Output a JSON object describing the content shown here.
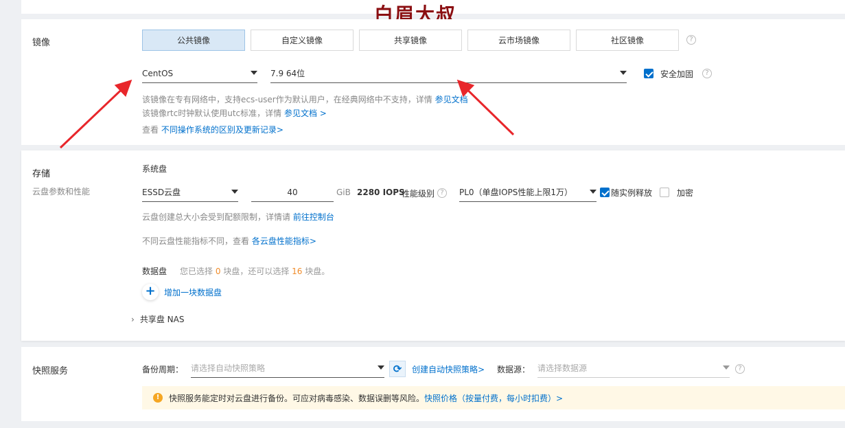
{
  "watermark": "白眉大叔",
  "image": {
    "section_label": "镜像",
    "tabs": [
      {
        "label": "公共镜像",
        "active": true
      },
      {
        "label": "自定义镜像",
        "active": false
      },
      {
        "label": "共享镜像",
        "active": false
      },
      {
        "label": "云市场镜像",
        "active": false
      },
      {
        "label": "社区镜像",
        "active": false
      }
    ],
    "os_value": "CentOS",
    "version_value": "7.9 64位",
    "security_label": "安全加固",
    "security_checked": true,
    "note1_prefix": "该镜像在专有网络中，支持ecs-user作为默认用户，在经典网络中不支持，详情",
    "note1_link": "参见文档",
    "note2_prefix": "该镜像rtc时钟默认使用utc标准，详情",
    "note2_link": "参见文档 >",
    "note3_prefix": "查看",
    "note3_link": "不同操作系统的区别及更新记录>"
  },
  "storage": {
    "section_label": "存储",
    "section_sublabel": "云盘参数和性能",
    "system_disk_label": "系统盘",
    "disk_type": "ESSD云盘",
    "size_value": "40",
    "unit": "GiB",
    "iops": "2280 IOPS",
    "perf_label": "性能级别",
    "perf_value": "PL0（单盘IOPS性能上限1万）",
    "release_label": "随实例释放",
    "release_checked": true,
    "encrypt_label": "加密",
    "encrypt_checked": false,
    "note1_prefix": "云盘创建总大小会受到配额限制，详情请",
    "note1_link": "前往控制台",
    "note2_prefix": "不同云盘性能指标不同，查看",
    "note2_link": "各云盘性能指标>",
    "data_disk_label": "数据盘",
    "data_disk_text1": "您已选择",
    "data_disk_selected": "0",
    "data_disk_text2": "块盘，还可以选择",
    "data_disk_remaining": "16",
    "data_disk_text3": "块盘。",
    "add_disk_label": "增加一块数据盘",
    "nas_label": "共享盘 NAS"
  },
  "snapshot": {
    "section_label": "快照服务",
    "period_label": "备份周期：",
    "period_placeholder": "请选择自动快照策略",
    "create_policy_link": "创建自动快照策略>",
    "source_label": "数据源：",
    "source_placeholder": "请选择数据源",
    "notice_text": "快照服务能定时对云盘进行备份。可应对病毒感染、数据误删等风险。",
    "notice_link": "快照价格（按量付费，每小时扣费）>"
  },
  "colors": {
    "accent": "#0070cc",
    "arrow": "#e8262b",
    "watermark": "#8b0f12",
    "notice_bg": "#fff8e6",
    "warn_icon": "#f5a623",
    "count_orange": "#f08c2a"
  },
  "icons": [
    "question-icon",
    "caret-down-icon",
    "check-icon",
    "plus-icon",
    "chevron-right-icon",
    "refresh-icon",
    "warning-icon",
    "arrow-annotation"
  ]
}
